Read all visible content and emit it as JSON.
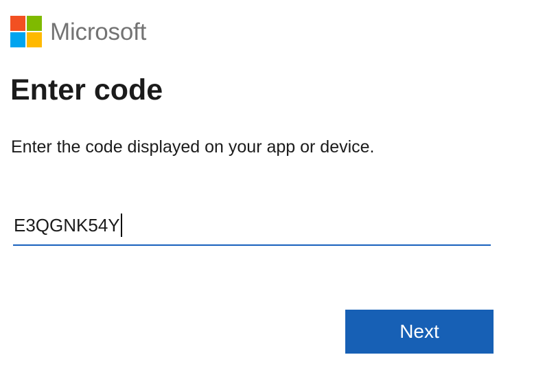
{
  "brand": {
    "name": "Microsoft",
    "logo_icon": "microsoft-four-squares-logo",
    "logo_colors": [
      "#f25022",
      "#7fba00",
      "#00a4ef",
      "#ffb900"
    ],
    "text_color": "#737373"
  },
  "title": "Enter code",
  "description": "Enter the code displayed on your app or device.",
  "code_input": {
    "value": "E3QGNK54Y",
    "focused": true,
    "underline_color": "#1760bd"
  },
  "next_button": {
    "label": "Next",
    "background": "#1760b5"
  }
}
